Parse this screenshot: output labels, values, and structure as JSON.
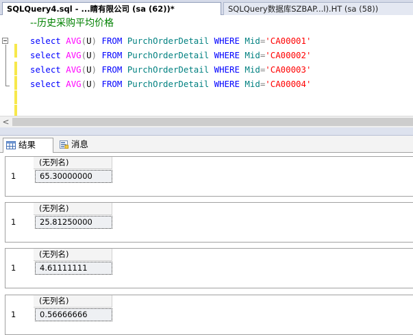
{
  "tabs": {
    "active": "SQLQuery4.sql - ...睛有限公司 (sa (62))*",
    "inactive": "SQLQuery数据库SZBAP...l).HT (sa (58))"
  },
  "editor": {
    "comment": "--历史采购平均价格",
    "lines": [
      {
        "kw_select": "select",
        "fn": "AVG",
        "paren_open": "(",
        "arg": "U",
        "paren_close": ")",
        "kw_from": "FROM",
        "table": "PurchOrderDetail",
        "kw_where": "WHERE",
        "column": "Mid",
        "op": "=",
        "value": "'CA00001'"
      },
      {
        "kw_select": "select",
        "fn": "AVG",
        "paren_open": "(",
        "arg": "U",
        "paren_close": ")",
        "kw_from": "FROM",
        "table": "PurchOrderDetail",
        "kw_where": "WHERE",
        "column": "Mid",
        "op": "=",
        "value": "'CA00002'"
      },
      {
        "kw_select": "select",
        "fn": "AVG",
        "paren_open": "(",
        "arg": "U",
        "paren_close": ")",
        "kw_from": "FROM",
        "table": "PurchOrderDetail",
        "kw_where": "WHERE",
        "column": "Mid",
        "op": "=",
        "value": "'CA00003'"
      },
      {
        "kw_select": "select",
        "fn": "AVG",
        "paren_open": "(",
        "arg": "U",
        "paren_close": ")",
        "kw_from": "FROM",
        "table": "PurchOrderDetail",
        "kw_where": "WHERE",
        "column": "Mid",
        "op": "=",
        "value": "'CA00004'"
      }
    ]
  },
  "scrollbar": {
    "left_arrow": "<"
  },
  "results_tabs": {
    "results_label": "结果",
    "messages_label": "消息"
  },
  "results": [
    {
      "column_header": "(无列名)",
      "row_number": "1",
      "value": "65.30000000"
    },
    {
      "column_header": "(无列名)",
      "row_number": "1",
      "value": "25.81250000"
    },
    {
      "column_header": "(无列名)",
      "row_number": "1",
      "value": "4.61111111"
    },
    {
      "column_header": "(无列名)",
      "row_number": "1",
      "value": "0.56666666"
    }
  ],
  "colors": {
    "keyword": "#0000ff",
    "function": "#ff00ff",
    "object": "#008080",
    "operator": "#808080",
    "string": "#ff0000",
    "comment": "#008000"
  },
  "icons": {
    "results_tab": "grid-icon",
    "messages_tab": "message-icon",
    "collapse": "collapse-minus-icon"
  }
}
